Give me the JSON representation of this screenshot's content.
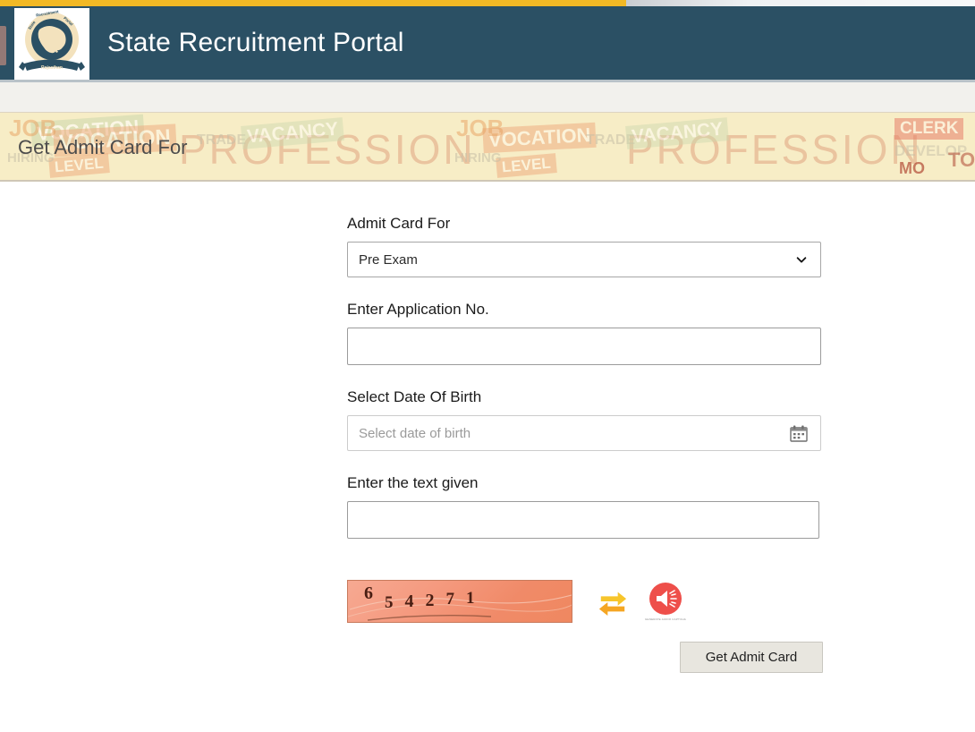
{
  "header": {
    "title": "State Recruitment Portal",
    "logo_alt": "State Recruitment Portal Rajasthan emblem",
    "logo_ring_text": "State Recruitment Portal",
    "logo_banner_text": "Rajasthan",
    "bar_color": "#2b5064",
    "accent_gold": "#f2b925"
  },
  "banner": {
    "title": "Get Admit Card For",
    "background_color": "#f7edc6",
    "decor_words": [
      "PROFESSION",
      "VOCATION",
      "VACANCY",
      "TRADE",
      "LEVEL",
      "CLERK",
      "DEVELOP",
      "MO",
      "TO",
      "HIRING",
      "JOB"
    ]
  },
  "form": {
    "fields": [
      {
        "label": "Admit Card For",
        "type": "select",
        "value": "Pre Exam",
        "options": [
          "Pre Exam"
        ]
      },
      {
        "label": "Enter Application No.",
        "type": "text",
        "value": "",
        "placeholder": ""
      },
      {
        "label": "Select Date Of Birth",
        "type": "date",
        "value": "",
        "placeholder": "Select date of birth",
        "icon": "calendar-icon"
      },
      {
        "label": "Enter the text given",
        "type": "text",
        "value": "",
        "placeholder": ""
      }
    ]
  },
  "captcha": {
    "digits": [
      "6",
      "5",
      "4",
      "2",
      "7",
      "1"
    ],
    "text": "654271",
    "background_color": "#f29a7c",
    "refresh_icon": "refresh-icon",
    "refresh_color": "#f5c518",
    "audio_icon": "audio-speaker-icon",
    "audio_color": "#ed4f4a",
    "audio_caption": "GENERATE AUDIO CAPTCHA"
  },
  "actions": {
    "submit_label": "Get Admit Card"
  }
}
